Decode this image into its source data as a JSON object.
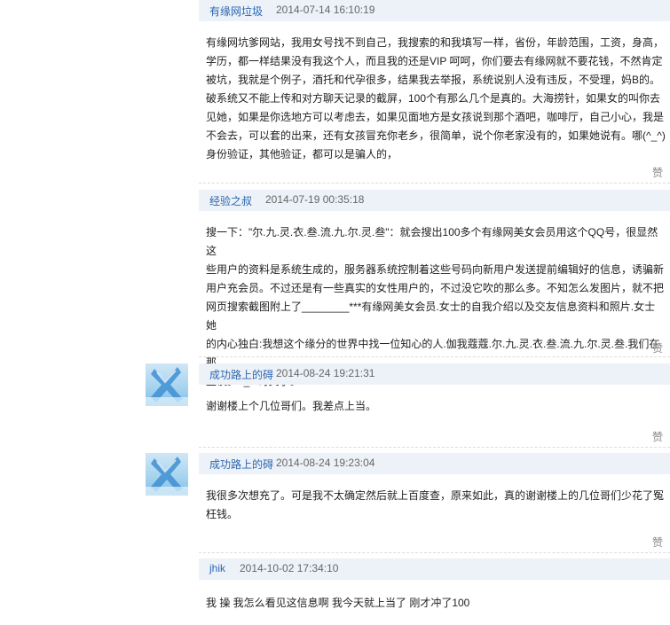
{
  "posts": [
    {
      "author": "有缘网垃圾",
      "time": "2014-07-14 16:10:19",
      "content": "有缘网坑爹网站，我用女号找不到自己，我搜索的和我填写一样，省份，年龄范围，工资，身高，\n学历，都一样结果没有我这个人，而且我的还是VIP 呵呵，你们要去有缘网就不要花钱，不然肯定\n被坑，我就是个例子，酒托和代孕很多，结果我去举报，系统说别人没有违反，不受理，妈B的。\n破系统又不能上传和对方聊天记录的截屏，100个有那么几个是真的。大海捞针，如果女的叫你去\n见她，如果是你选地方可以考虑去，如果见面地方是女孩说到那个酒吧，咖啡厅，自己小心，我是\n不会去，可以套的出来，还有女孩冒充你老乡，很简单，说个你老家没有的，如果她说有。哪(^_^)\n身份验证，其他验证，都可以是骗人的，",
      "like": "赞"
    },
    {
      "author": "经验之叔",
      "time": "2014-07-19 00:35:18",
      "content": "搜一下：\"尔.九.灵.衣.叁.流.九.尔.灵.叁\"：就会搜出100多个有缘网美女会员用这个QQ号，很显然这\n些用户的资料是系统生成的，服务器系统控制着这些号码向新用户发送提前编辑好的信息，诱骗新\n用户充会员。不过还是有一些真实的女性用户的，不过没它吹的那么多。不知怎么发图片，就不把\n网页搜索截图附上了________***有缘网美女会员.女士的自我介绍以及交友信息资料和照片.女士她\n的内心独白:我想这个缘分的世界中找一位知心的人.伽我蔻蔻.尔.九.灵.衣.叁.流.九.尔.灵.叁.我们在那\n里谈。o_O哥笑了。",
      "like": "赞"
    },
    {
      "author": "成功路上的碍",
      "time": "2014-08-24 19:21:31",
      "content": "谢谢楼上个几位哥们。我差点上当。",
      "like": "赞"
    },
    {
      "author": "成功路上的碍",
      "time": "2014-08-24 19:23:04",
      "content": "我很多次想充了。可是我不太确定然后就上百度查，原来如此，真的谢谢楼上的几位哥们少花了冤\n枉钱。",
      "like": "赞"
    },
    {
      "author": "jhik",
      "time": "2014-10-02 17:34:10",
      "content": "我 操 我怎么看见这信息啊 我今天就上当了 刚才冲了100"
    }
  ],
  "colors": {
    "author_link": "#2b66b0",
    "header_bg": "#edf2f8",
    "avatar": "#8cc8ec"
  },
  "icons": {
    "avatar": "blue-x-avatar-icon"
  }
}
